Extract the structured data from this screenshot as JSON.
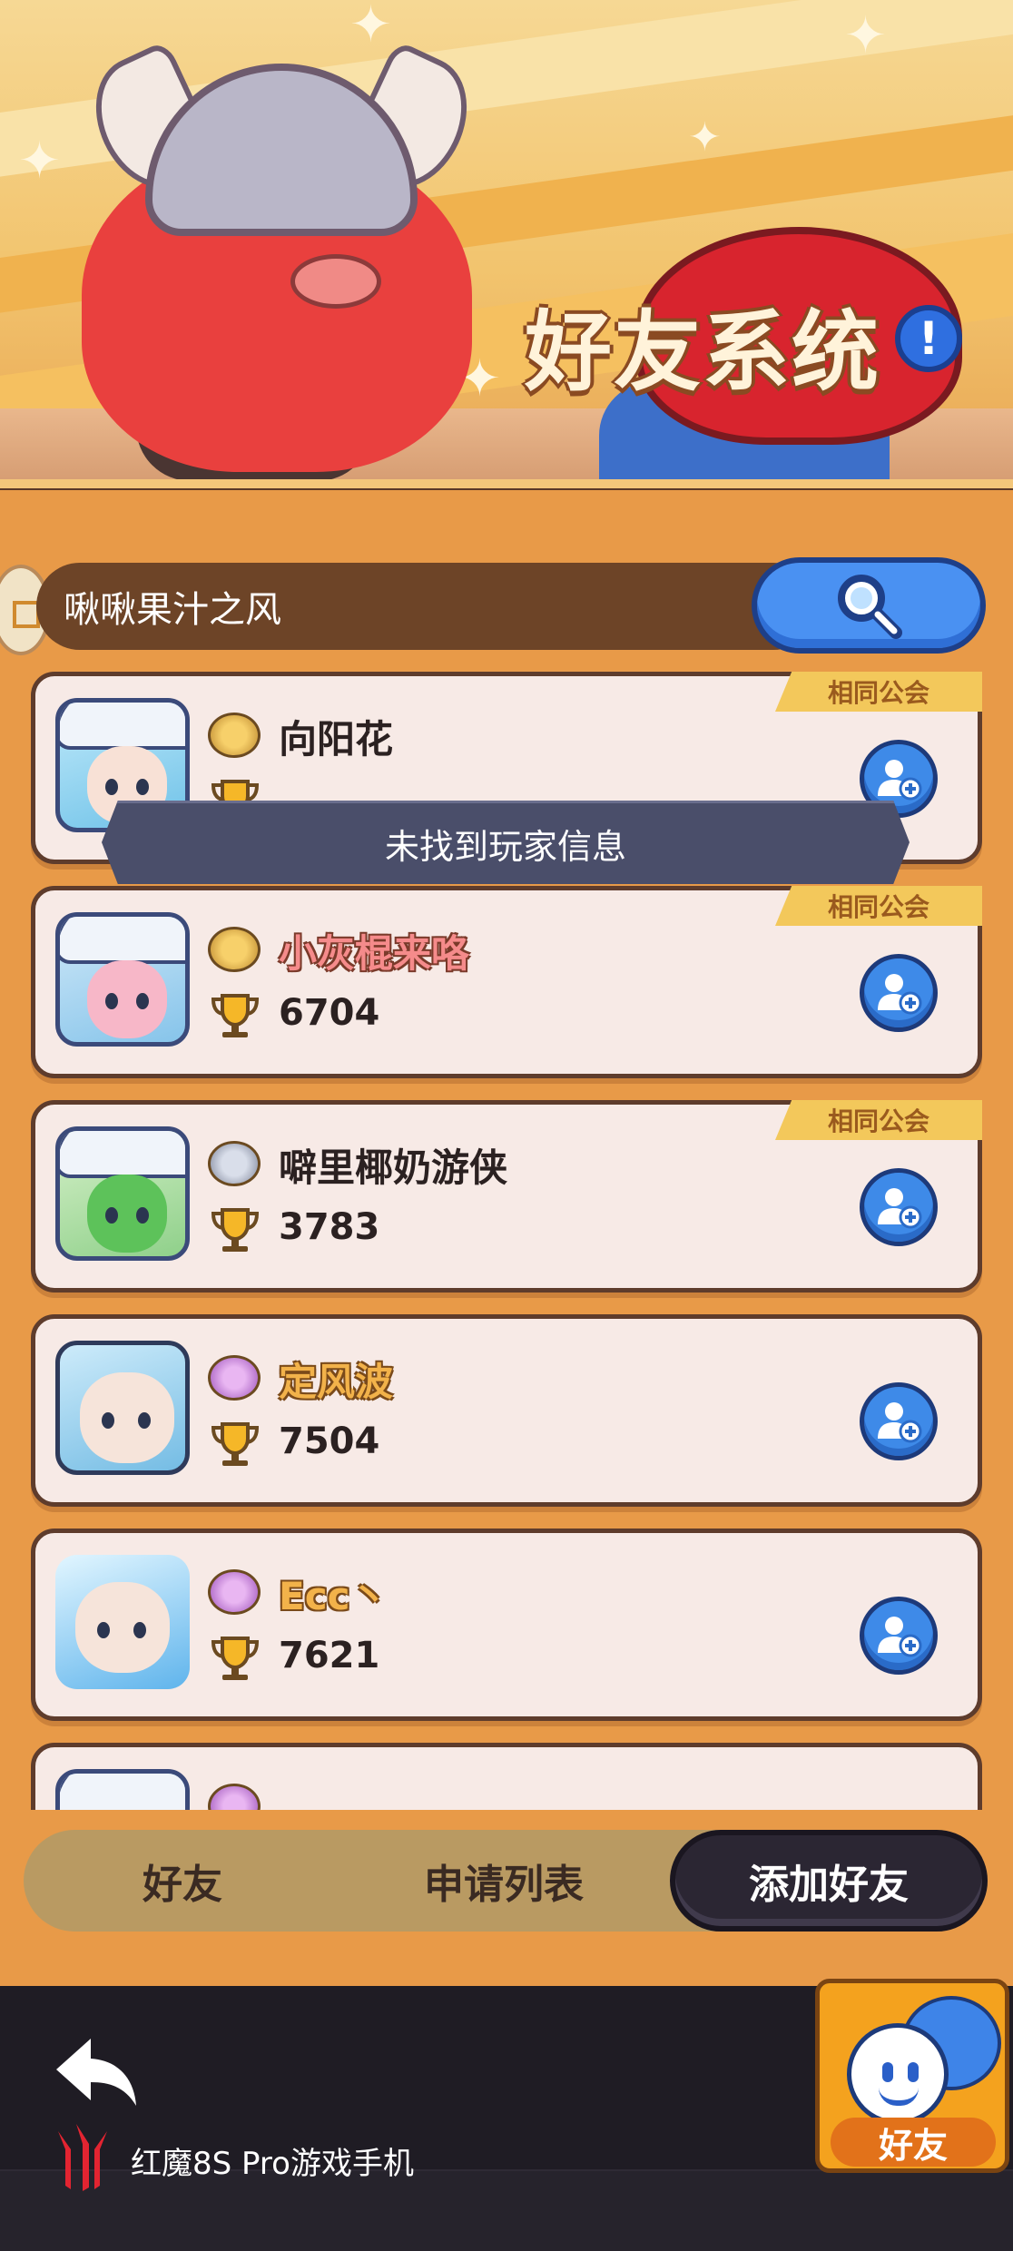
{
  "banner": {
    "title": "好友系统",
    "info_symbol": "!"
  },
  "search": {
    "value": "啾啾果汁之风",
    "button_icon": "search-icon"
  },
  "toast": {
    "message": "未找到玩家信息"
  },
  "players": [
    {
      "name": "向阳花",
      "trophies": "",
      "guild_tag": "相同公会",
      "rank_icon": "gold-helmet-icon"
    },
    {
      "name": "小灰棍来咯",
      "trophies": "6704",
      "guild_tag": "相同公会",
      "rank_icon": "gold-crown-icon"
    },
    {
      "name": "噼里椰奶游侠",
      "trophies": "3783",
      "guild_tag": "相同公会",
      "rank_icon": "silver-helmet-icon"
    },
    {
      "name": "定风波",
      "trophies": "7504",
      "guild_tag": "",
      "rank_icon": "purple-crown-icon"
    },
    {
      "name": "Ecc丶",
      "trophies": "7621",
      "guild_tag": "",
      "rank_icon": "purple-crown-icon"
    }
  ],
  "tabs": [
    {
      "label": "好友",
      "active": false
    },
    {
      "label": "申请列表",
      "active": false
    },
    {
      "label": "添加好友",
      "active": true
    }
  ],
  "friends_button": {
    "label": "好友"
  },
  "system_bar": {
    "brand_text": "红魔8S Pro游戏手机",
    "back_icon": "back-arrow-icon"
  },
  "colors": {
    "accent_blue": "#3E8AE8",
    "guild_tag": "#F3C85B",
    "background": "#E89A48"
  }
}
